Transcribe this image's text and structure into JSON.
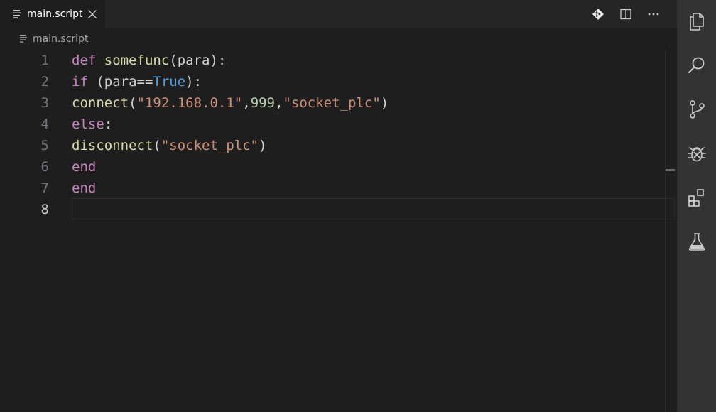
{
  "tab": {
    "label": "main.script",
    "file_icon": "file-lines-icon",
    "close_icon": "close-icon"
  },
  "toolbar": {
    "items": [
      {
        "name": "source-control-diamond-icon"
      },
      {
        "name": "split-editor-icon"
      },
      {
        "name": "more-actions-icon"
      }
    ]
  },
  "breadcrumb": {
    "label": "main.script",
    "icon": "file-lines-icon"
  },
  "editor": {
    "active_line": 8,
    "lines": [
      {
        "number": "1",
        "tokens": [
          {
            "text": "def",
            "kind": "keyword"
          },
          {
            "text": " ",
            "kind": "plain"
          },
          {
            "text": "somefunc",
            "kind": "function"
          },
          {
            "text": "(para):",
            "kind": "plain"
          }
        ]
      },
      {
        "number": "2",
        "tokens": [
          {
            "text": "if",
            "kind": "keyword"
          },
          {
            "text": " (para==",
            "kind": "plain"
          },
          {
            "text": "True",
            "kind": "constant"
          },
          {
            "text": "):",
            "kind": "plain"
          }
        ]
      },
      {
        "number": "3",
        "tokens": [
          {
            "text": "connect",
            "kind": "function"
          },
          {
            "text": "(",
            "kind": "plain"
          },
          {
            "text": "\"192.168.0.1\"",
            "kind": "string"
          },
          {
            "text": ",",
            "kind": "plain"
          },
          {
            "text": "999",
            "kind": "number"
          },
          {
            "text": ",",
            "kind": "plain"
          },
          {
            "text": "\"socket_plc\"",
            "kind": "string"
          },
          {
            "text": ")",
            "kind": "plain"
          }
        ]
      },
      {
        "number": "4",
        "tokens": [
          {
            "text": "else",
            "kind": "keyword"
          },
          {
            "text": ":",
            "kind": "plain"
          }
        ]
      },
      {
        "number": "5",
        "tokens": [
          {
            "text": "disconnect",
            "kind": "function"
          },
          {
            "text": "(",
            "kind": "plain"
          },
          {
            "text": "\"socket_plc\"",
            "kind": "string"
          },
          {
            "text": ")",
            "kind": "plain"
          }
        ]
      },
      {
        "number": "6",
        "tokens": [
          {
            "text": "end",
            "kind": "keyword"
          }
        ]
      },
      {
        "number": "7",
        "tokens": [
          {
            "text": "end",
            "kind": "keyword"
          }
        ]
      },
      {
        "number": "8",
        "tokens": []
      }
    ]
  },
  "activity_bar": {
    "items": [
      {
        "name": "explorer-files-icon"
      },
      {
        "name": "search-icon"
      },
      {
        "name": "source-control-icon"
      },
      {
        "name": "run-debug-bug-icon"
      },
      {
        "name": "extensions-icon"
      },
      {
        "name": "testing-flask-icon"
      }
    ]
  },
  "colors": {
    "editor_bg": "#1e1e1e",
    "tabbar_bg": "#252526",
    "activity_bar_bg": "#333333",
    "keyword": "#c586c0",
    "function": "#dcdcaa",
    "string": "#ce9178",
    "number": "#b5cea8",
    "constant": "#569cd6",
    "text": "#d4d4d4"
  }
}
